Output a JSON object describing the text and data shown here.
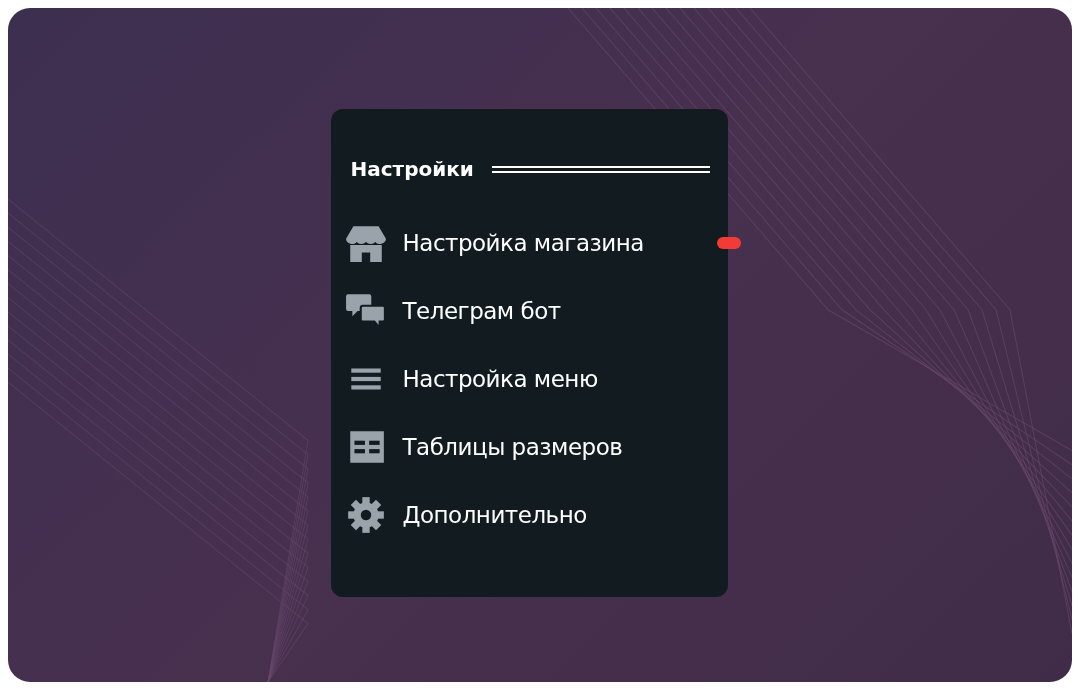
{
  "menu": {
    "title": "Настройки",
    "items": [
      {
        "label": "Настройка магазина",
        "kind": "store",
        "selected": true
      },
      {
        "label": "Телеграм бот",
        "kind": "chat",
        "selected": false
      },
      {
        "label": "Настройка меню",
        "kind": "lines",
        "selected": false
      },
      {
        "label": "Таблицы размеров",
        "kind": "table",
        "selected": false
      },
      {
        "label": "Дополнительно",
        "kind": "gear",
        "selected": false
      }
    ]
  }
}
